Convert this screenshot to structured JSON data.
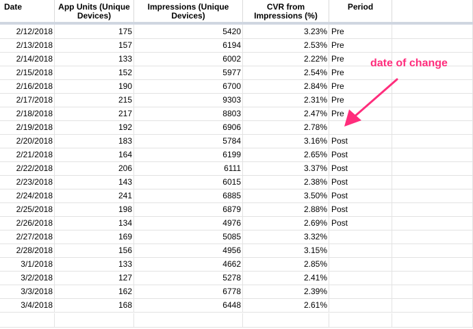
{
  "header": {
    "date": "Date",
    "app_units": "App Units (Unique Devices)",
    "impressions": "Impressions (Unique Devices)",
    "cvr": "CVR from Impressions (%)",
    "period": "Period"
  },
  "rows": [
    {
      "date": "2/12/2018",
      "units": "175",
      "impressions": "5420",
      "cvr": "3.23%",
      "period": "Pre"
    },
    {
      "date": "2/13/2018",
      "units": "157",
      "impressions": "6194",
      "cvr": "2.53%",
      "period": "Pre"
    },
    {
      "date": "2/14/2018",
      "units": "133",
      "impressions": "6002",
      "cvr": "2.22%",
      "period": "Pre"
    },
    {
      "date": "2/15/2018",
      "units": "152",
      "impressions": "5977",
      "cvr": "2.54%",
      "period": "Pre"
    },
    {
      "date": "2/16/2018",
      "units": "190",
      "impressions": "6700",
      "cvr": "2.84%",
      "period": "Pre"
    },
    {
      "date": "2/17/2018",
      "units": "215",
      "impressions": "9303",
      "cvr": "2.31%",
      "period": "Pre"
    },
    {
      "date": "2/18/2018",
      "units": "217",
      "impressions": "8803",
      "cvr": "2.47%",
      "period": "Pre"
    },
    {
      "date": "2/19/2018",
      "units": "192",
      "impressions": "6906",
      "cvr": "2.78%",
      "period": ""
    },
    {
      "date": "2/20/2018",
      "units": "183",
      "impressions": "5784",
      "cvr": "3.16%",
      "period": "Post"
    },
    {
      "date": "2/21/2018",
      "units": "164",
      "impressions": "6199",
      "cvr": "2.65%",
      "period": "Post"
    },
    {
      "date": "2/22/2018",
      "units": "206",
      "impressions": "6111",
      "cvr": "3.37%",
      "period": "Post"
    },
    {
      "date": "2/23/2018",
      "units": "143",
      "impressions": "6015",
      "cvr": "2.38%",
      "period": "Post"
    },
    {
      "date": "2/24/2018",
      "units": "241",
      "impressions": "6885",
      "cvr": "3.50%",
      "period": "Post"
    },
    {
      "date": "2/25/2018",
      "units": "198",
      "impressions": "6879",
      "cvr": "2.88%",
      "period": "Post"
    },
    {
      "date": "2/26/2018",
      "units": "134",
      "impressions": "4976",
      "cvr": "2.69%",
      "period": "Post"
    },
    {
      "date": "2/27/2018",
      "units": "169",
      "impressions": "5085",
      "cvr": "3.32%",
      "period": ""
    },
    {
      "date": "2/28/2018",
      "units": "156",
      "impressions": "4956",
      "cvr": "3.15%",
      "period": ""
    },
    {
      "date": "3/1/2018",
      "units": "133",
      "impressions": "4662",
      "cvr": "2.85%",
      "period": ""
    },
    {
      "date": "3/2/2018",
      "units": "127",
      "impressions": "5278",
      "cvr": "2.41%",
      "period": ""
    },
    {
      "date": "3/3/2018",
      "units": "162",
      "impressions": "6778",
      "cvr": "2.39%",
      "period": ""
    },
    {
      "date": "3/4/2018",
      "units": "168",
      "impressions": "6448",
      "cvr": "2.61%",
      "period": ""
    }
  ],
  "annotation": {
    "text": "date of change",
    "color": "#ff2d7c"
  },
  "colors": {
    "header_divider": "#cfd6e0",
    "grid": "#e2e2e2"
  }
}
